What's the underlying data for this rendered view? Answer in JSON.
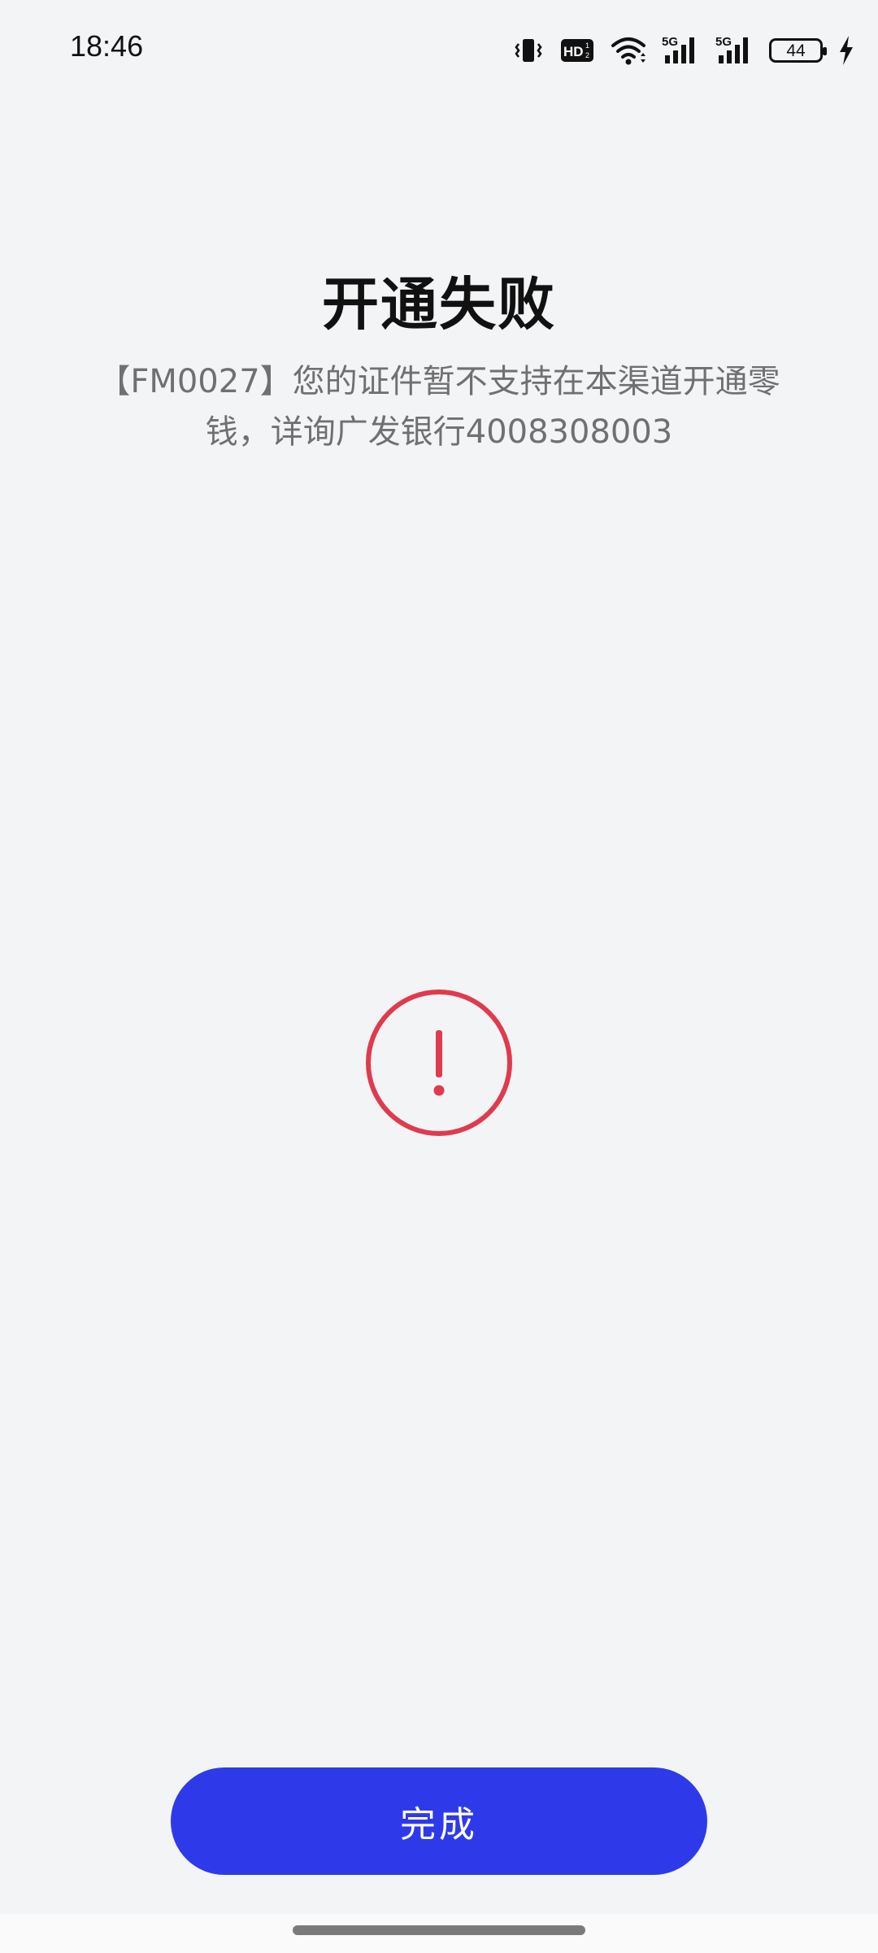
{
  "status_bar": {
    "time": "18:46",
    "battery_level": "44",
    "icons": [
      "vibrate-icon",
      "hd-icon",
      "wifi-icon",
      "signal-5g-icon",
      "signal-5g-icon",
      "battery-icon",
      "charging-icon"
    ]
  },
  "page": {
    "title": "开通失败",
    "message": "【FM0027】您的证件暂不支持在本渠道开通零钱，详询广发银行4008308003"
  },
  "alert": {
    "icon": "exclamation-circle-icon",
    "color": "#e03a4e"
  },
  "actions": {
    "done_label": "完成",
    "done_color": "#2e3aea"
  }
}
